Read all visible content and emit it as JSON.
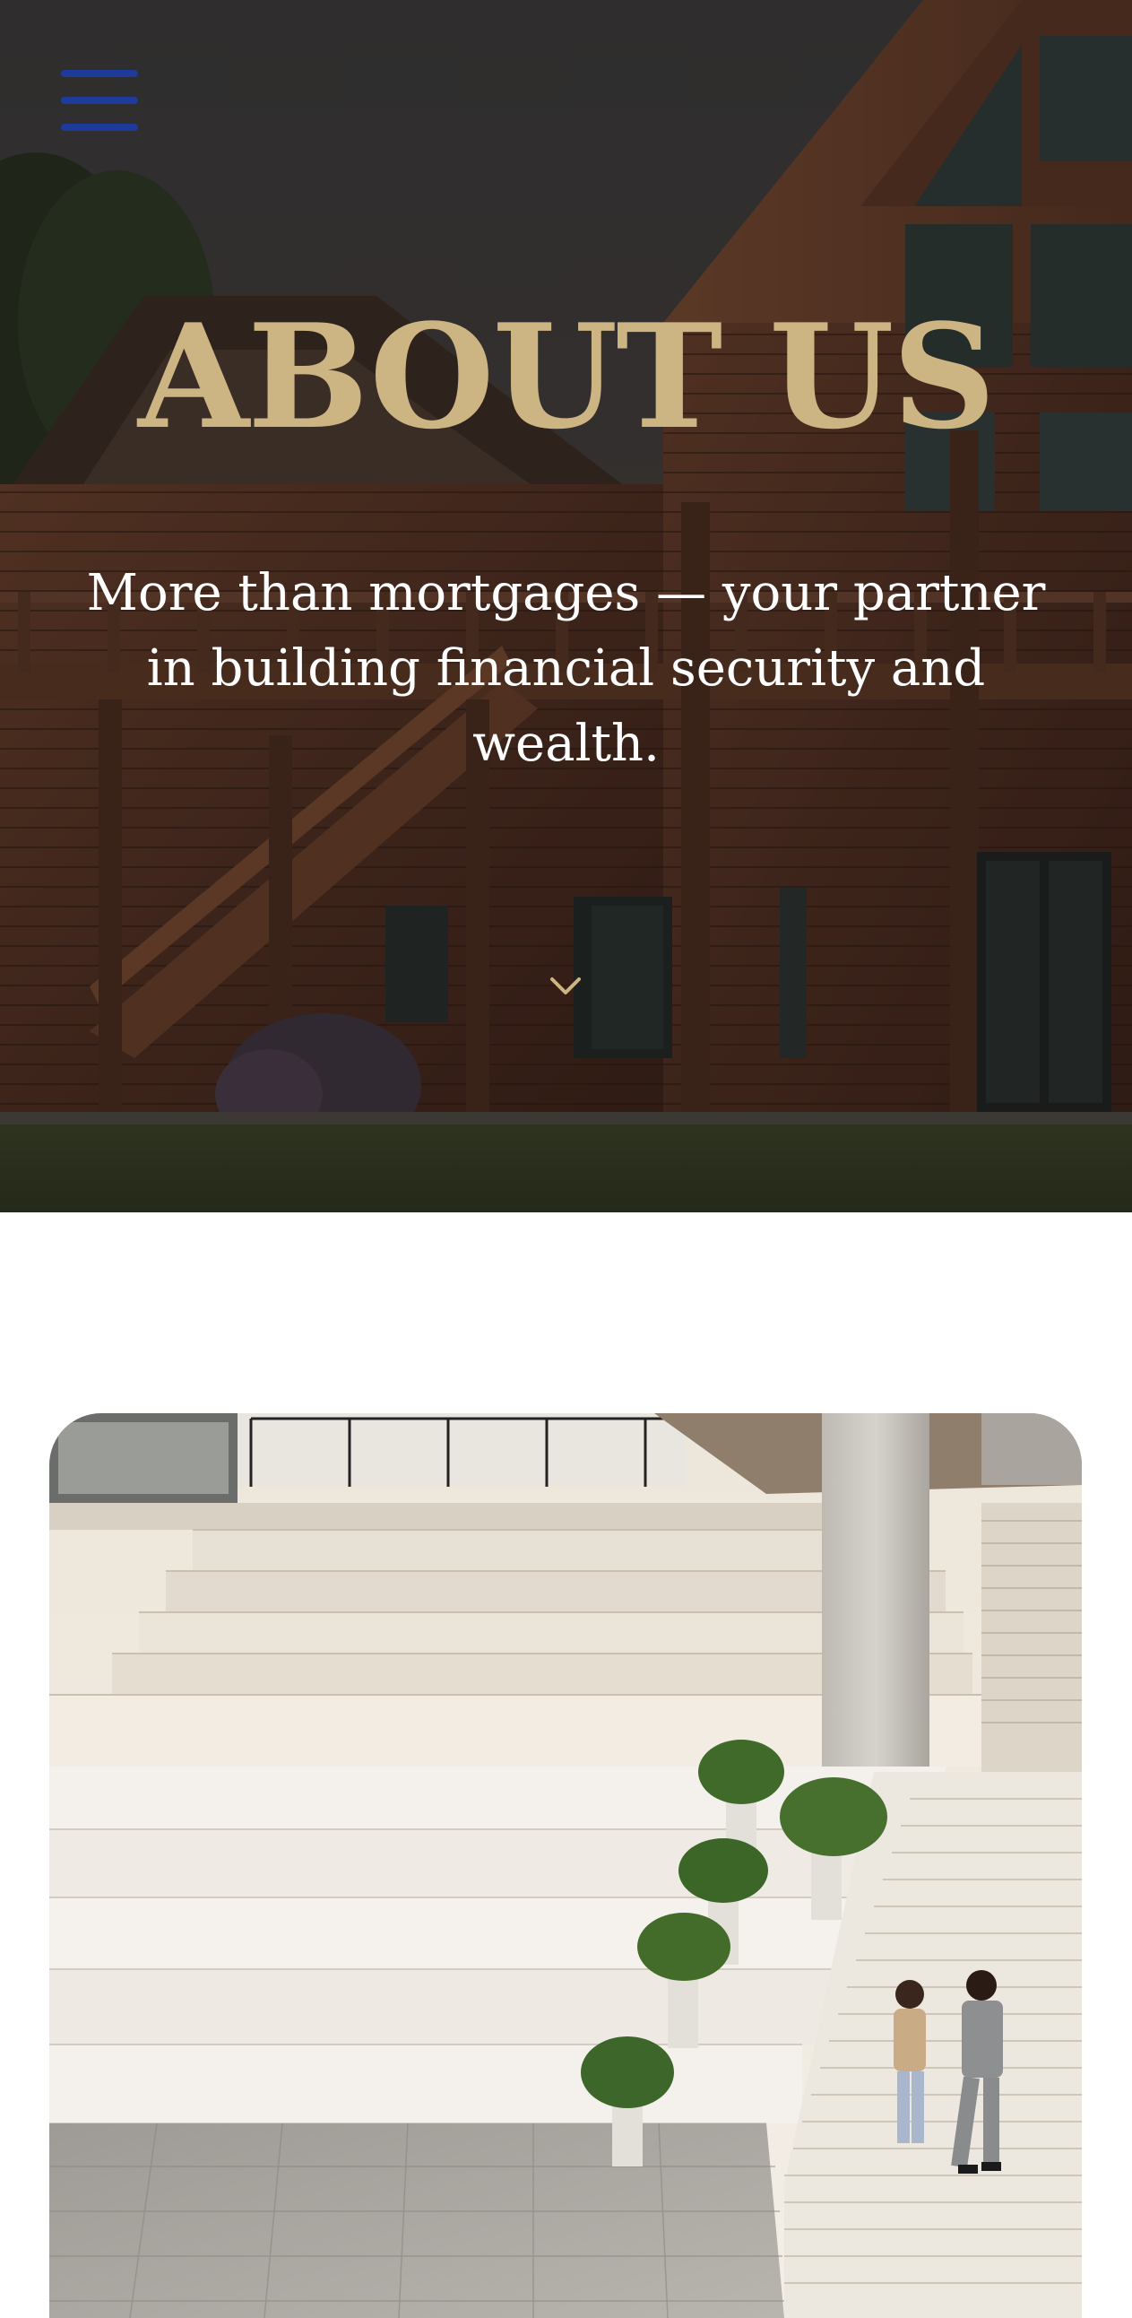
{
  "nav": {
    "menu_icon": "hamburger-menu-icon",
    "menu_color": "#1e3a9a"
  },
  "hero": {
    "title": "ABOUT US",
    "subtitle": "More than mortgages — your partner in building financial security and wealth.",
    "scroll_icon": "chevron-down-icon",
    "title_color": "#cdb483",
    "image_subject": "log-cabin-house-photo"
  },
  "feature": {
    "image_subject": "office-stairs-business-people-photo"
  }
}
